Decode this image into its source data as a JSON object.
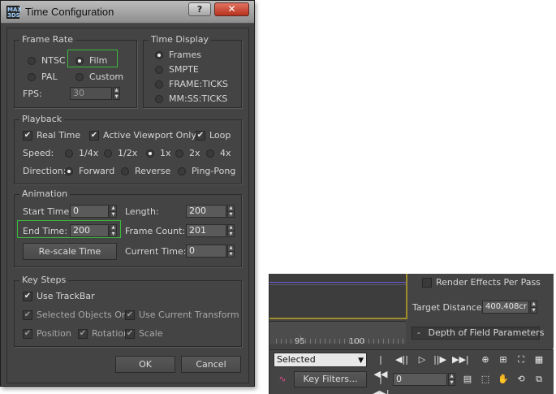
{
  "dialog": {
    "title": "Time Configuration",
    "app_icon_text": "MAX\n3DS",
    "help_label": "?",
    "close_label": "✕",
    "frame_rate": {
      "title": "Frame Rate",
      "options": [
        "NTSC",
        "Film",
        "PAL",
        "Custom"
      ],
      "selected": "Film",
      "fps_label": "FPS:",
      "fps_value": "30"
    },
    "time_display": {
      "title": "Time Display",
      "options": [
        "Frames",
        "SMPTE",
        "FRAME:TICKS",
        "MM:SS:TICKS"
      ],
      "selected": "Frames"
    },
    "playback": {
      "title": "Playback",
      "real_time": "Real Time",
      "active_viewport_only": "Active Viewport Only",
      "loop": "Loop",
      "speed_label": "Speed:",
      "speeds": [
        "1/4x",
        "1/2x",
        "1x",
        "2x",
        "4x"
      ],
      "speed_selected": "1x",
      "direction_label": "Direction:",
      "directions": [
        "Forward",
        "Reverse",
        "Ping-Pong"
      ],
      "direction_selected": "Forward"
    },
    "animation": {
      "title": "Animation",
      "start_time_label": "Start Time:",
      "start_time": "0",
      "length_label": "Length:",
      "length": "200",
      "end_time_label": "End Time:",
      "end_time": "200",
      "frame_count_label": "Frame Count:",
      "frame_count": "201",
      "rescale_label": "Re-scale Time",
      "current_time_label": "Current Time:",
      "current_time": "0"
    },
    "key_steps": {
      "title": "Key Steps",
      "use_trackbar": "Use TrackBar",
      "selected_objects_only": "Selected Objects Only",
      "use_current_transform": "Use Current Transform",
      "position": "Position",
      "rotation": "Rotation",
      "scale": "Scale"
    },
    "ok_label": "OK",
    "cancel_label": "Cancel"
  },
  "main_window": {
    "render_effects": "Render Effects Per Pass",
    "target_distance_label": "Target Distance:",
    "target_distance_value": "400,408cr",
    "dof_params": "Depth of Field Parameters",
    "dof_prefix": "-",
    "timeline_labels": [
      "95",
      "100"
    ],
    "selection_set": "Selected",
    "key_filters": "Key Filters...",
    "frame_field": "0"
  },
  "colors": {
    "highlight": "#3bbb3b",
    "ui_background": "#444444",
    "viewport_border": "#a08c2c"
  }
}
